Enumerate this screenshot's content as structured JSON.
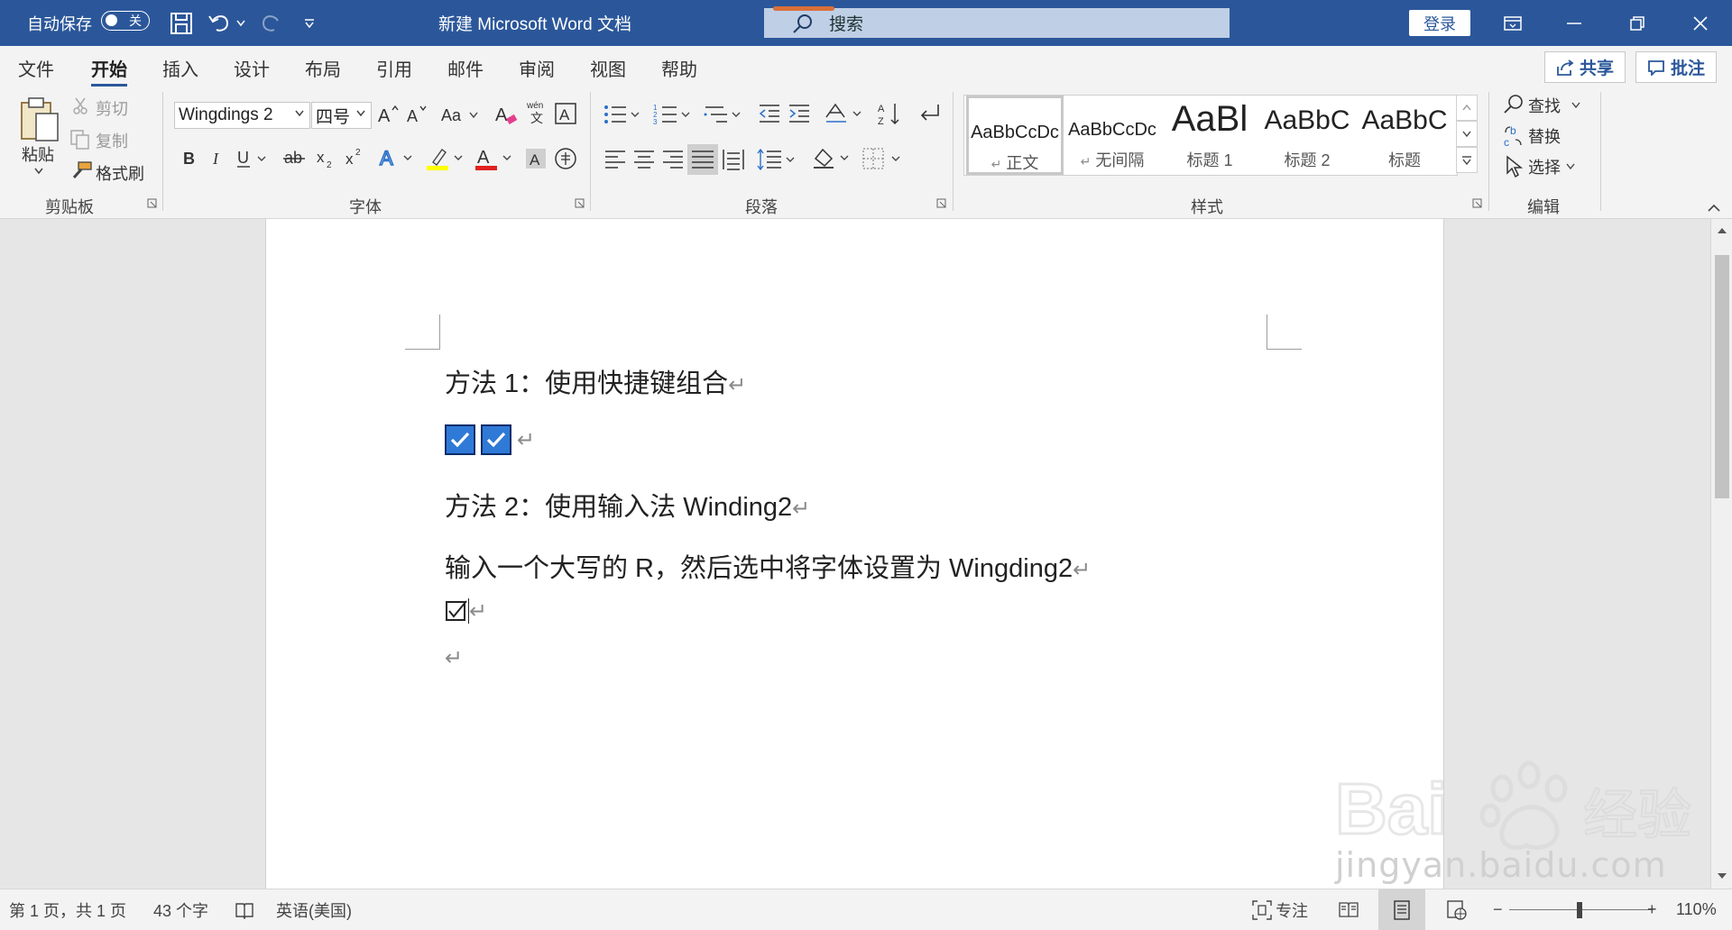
{
  "titlebar": {
    "autosave_label": "自动保存",
    "autosave_state": "关",
    "document_title": "新建 Microsoft Word 文档",
    "search_label": "搜索",
    "login_label": "登录"
  },
  "tabs": {
    "file": "文件",
    "home": "开始",
    "insert": "插入",
    "design": "设计",
    "layout": "布局",
    "references": "引用",
    "mailings": "邮件",
    "review": "审阅",
    "view": "视图",
    "help": "帮助",
    "share": "共享",
    "comments": "批注",
    "active": "开始"
  },
  "ribbon": {
    "clipboard": {
      "paste": "粘贴",
      "cut": "剪切",
      "copy": "复制",
      "format_painter": "格式刷",
      "group_label": "剪贴板"
    },
    "font": {
      "font_name": "Wingdings 2",
      "font_size": "四号",
      "bold": "B",
      "italic": "I",
      "underline": "U",
      "strike": "ab",
      "subscript": "x",
      "superscript": "x",
      "group_label": "字体",
      "highlight_color": "#ffff00",
      "font_color": "#e02020"
    },
    "paragraph": {
      "group_label": "段落"
    },
    "styles": {
      "items": [
        {
          "preview": "AaBbCcDc",
          "name": "正文",
          "pilcrow": "↵"
        },
        {
          "preview": "AaBbCcDc",
          "name": "无间隔",
          "pilcrow": "↵"
        },
        {
          "preview": "AaBl",
          "name": "标题 1"
        },
        {
          "preview": "AaBbC",
          "name": "标题 2"
        },
        {
          "preview": "AaBbC",
          "name": "标题"
        }
      ],
      "group_label": "样式"
    },
    "editing": {
      "find": "查找",
      "replace": "替换",
      "select": "选择",
      "group_label": "编辑"
    }
  },
  "document": {
    "line1": "方法 1：使用快捷键组合",
    "line3": "方法 2：使用输入法 Winding2",
    "line4": "输入一个大写的 R，然后选中将字体设置为 Wingding2",
    "pilcrow": "↵",
    "checkbox_color": "#2f7ad6"
  },
  "statusbar": {
    "page_info": "第 1 页，共 1 页",
    "word_count": "43 个字",
    "language": "英语(美国)",
    "focus": "专注",
    "zoom": "110%",
    "zoom_minus": "−",
    "zoom_plus": "+"
  },
  "watermark": {
    "text": "jingyan.baidu.com"
  }
}
